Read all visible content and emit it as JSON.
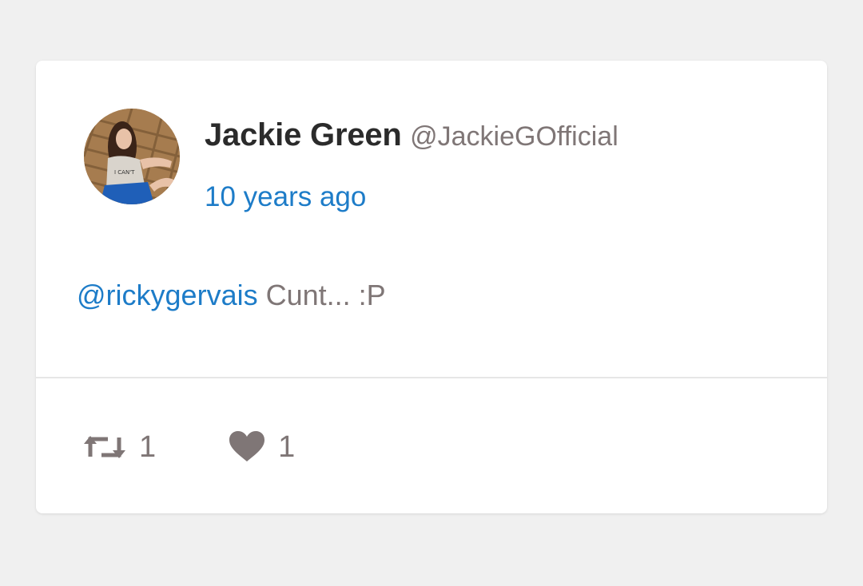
{
  "tweet": {
    "author": {
      "display_name": "Jackie Green",
      "handle": "@JackieGOfficial",
      "avatar_alt": "Jackie Green profile photo"
    },
    "timestamp": "10 years ago",
    "mention": "@rickygervais",
    "text": " Cunt... :P",
    "actions": {
      "retweet": {
        "icon": "retweet-icon",
        "count": "1"
      },
      "like": {
        "icon": "heart-icon",
        "count": "1"
      }
    }
  },
  "colors": {
    "background": "#f0f0f0",
    "card": "#ffffff",
    "link": "#1d7cc8",
    "muted": "#7f7676",
    "name": "#2b2b2b"
  }
}
